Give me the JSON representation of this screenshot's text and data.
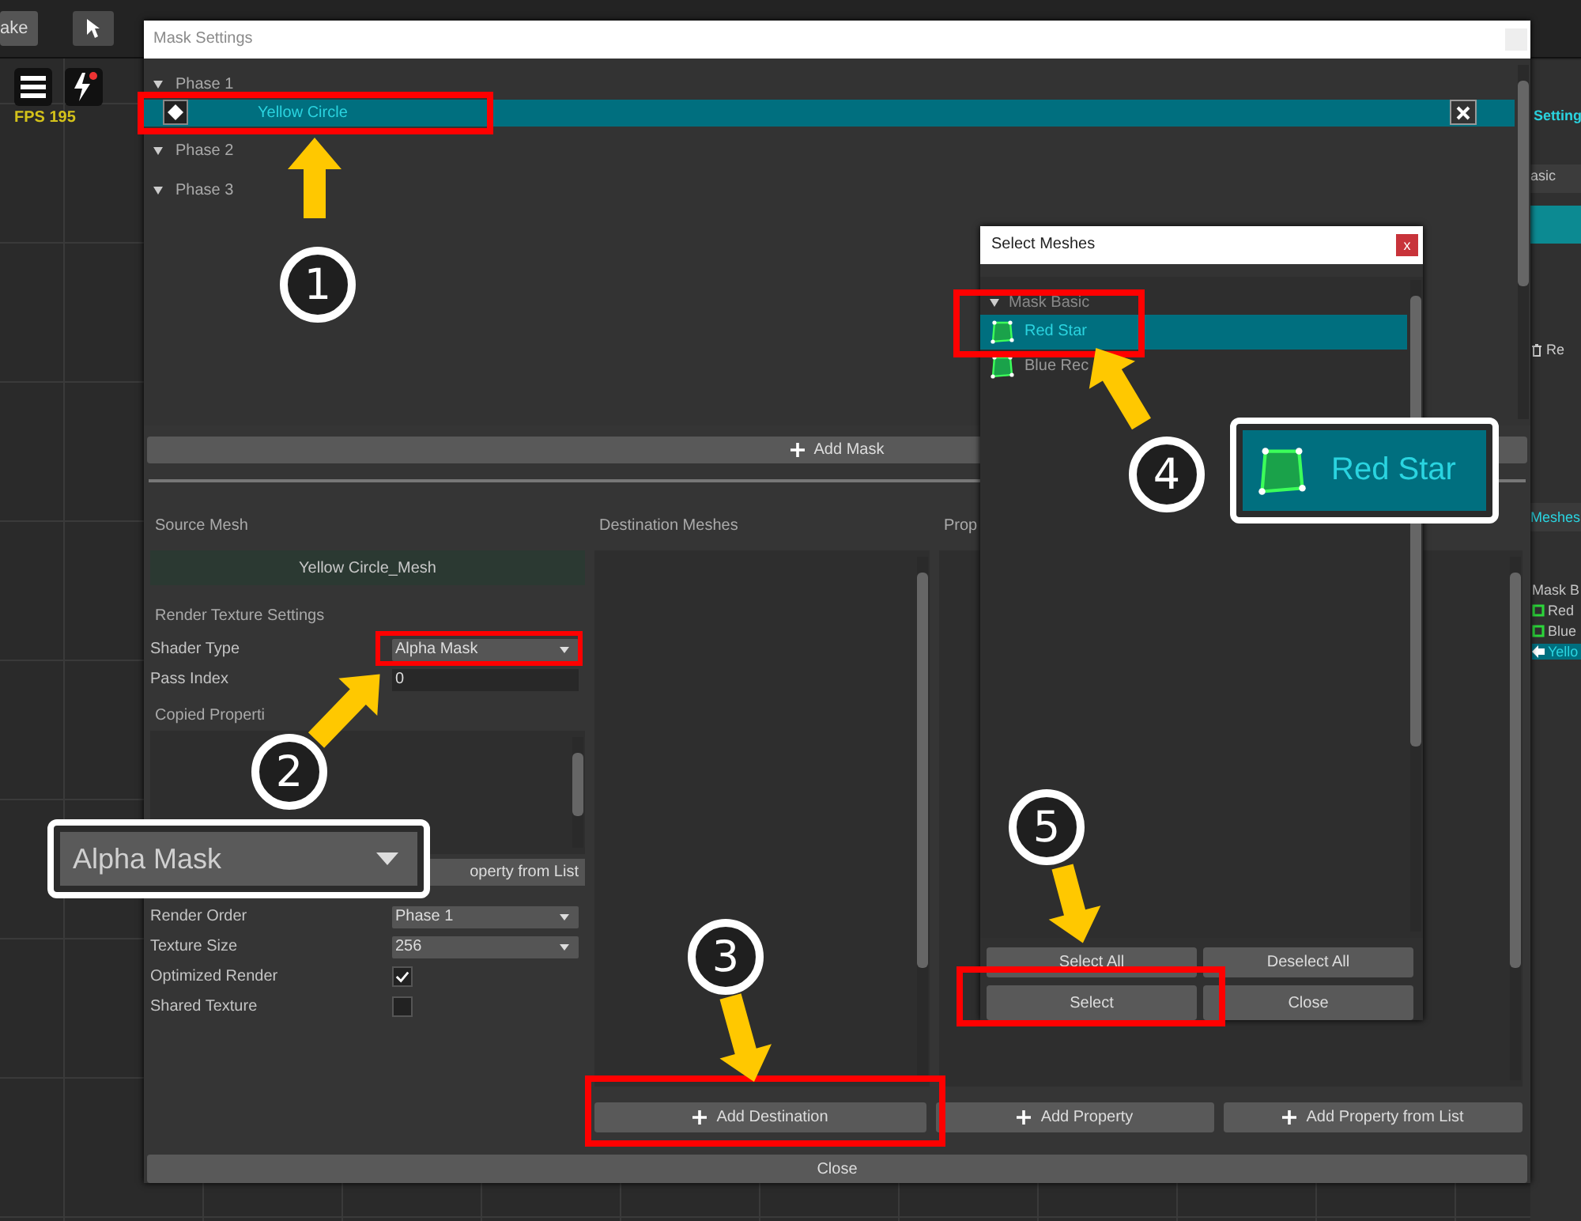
{
  "background_app": {
    "toolbar_button": "ake",
    "fps": "FPS 195",
    "right_panel": {
      "title": "Setting",
      "tab": "asic",
      "remove_button": "Re",
      "meshes_header": "Meshes",
      "tree": [
        {
          "label": "Mask B",
          "kind": "group",
          "selected": false
        },
        {
          "label": "Red",
          "kind": "mesh",
          "selected": false
        },
        {
          "label": "Blue",
          "kind": "mesh",
          "selected": false
        },
        {
          "label": "Yello",
          "kind": "mask",
          "selected": true
        }
      ]
    }
  },
  "mask_settings": {
    "title": "Mask Settings",
    "phases": [
      {
        "label": "Phase 1",
        "expanded": true,
        "children": [
          {
            "label": "Yellow Circle",
            "selected": true
          }
        ]
      },
      {
        "label": "Phase 2",
        "expanded": true
      },
      {
        "label": "Phase 3",
        "expanded": true
      }
    ],
    "add_mask_button": "Add Mask",
    "source_mesh": {
      "label": "Source Mesh",
      "mesh": "Yellow Circle_Mesh"
    },
    "render_texture_settings": {
      "label": "Render Texture Settings",
      "shader_type": {
        "label": "Shader Type",
        "value": "Alpha Mask"
      },
      "pass_index": {
        "label": "Pass Index",
        "value": "0"
      },
      "copied_properties": {
        "label": "Copied Properti",
        "button": "operty from List"
      },
      "rows": [
        {
          "label": "Render Order",
          "kind": "dropdown",
          "value": "Phase 1"
        },
        {
          "label": "Texture Size",
          "kind": "dropdown",
          "value": "256"
        },
        {
          "label": "Optimized Render",
          "kind": "checkbox",
          "checked": true
        },
        {
          "label": "Shared Texture",
          "kind": "checkbox",
          "checked": false
        }
      ]
    },
    "destination": {
      "label": "Destination Meshes",
      "button": "Add Destination"
    },
    "properties": {
      "label": "Prop",
      "buttons": [
        "Add Property",
        "Add Property from List"
      ]
    },
    "close_button": "Close"
  },
  "select_meshes_dialog": {
    "title": "Select Meshes",
    "close": "x",
    "items": [
      {
        "label": "Mask Basic",
        "kind": "group",
        "selected": false
      },
      {
        "label": "Red Star",
        "kind": "mesh",
        "selected": true
      },
      {
        "label": "Blue Rec",
        "kind": "mesh",
        "selected": false
      }
    ],
    "buttons": [
      "Select All",
      "Deselect All",
      "Select",
      "Close"
    ]
  },
  "annotations": {
    "steps": [
      "1",
      "2",
      "3",
      "4",
      "5"
    ],
    "callouts": [
      {
        "kind": "dropdown",
        "text": "Alpha Mask"
      },
      {
        "kind": "mesh",
        "text": "Red Star"
      }
    ]
  }
}
